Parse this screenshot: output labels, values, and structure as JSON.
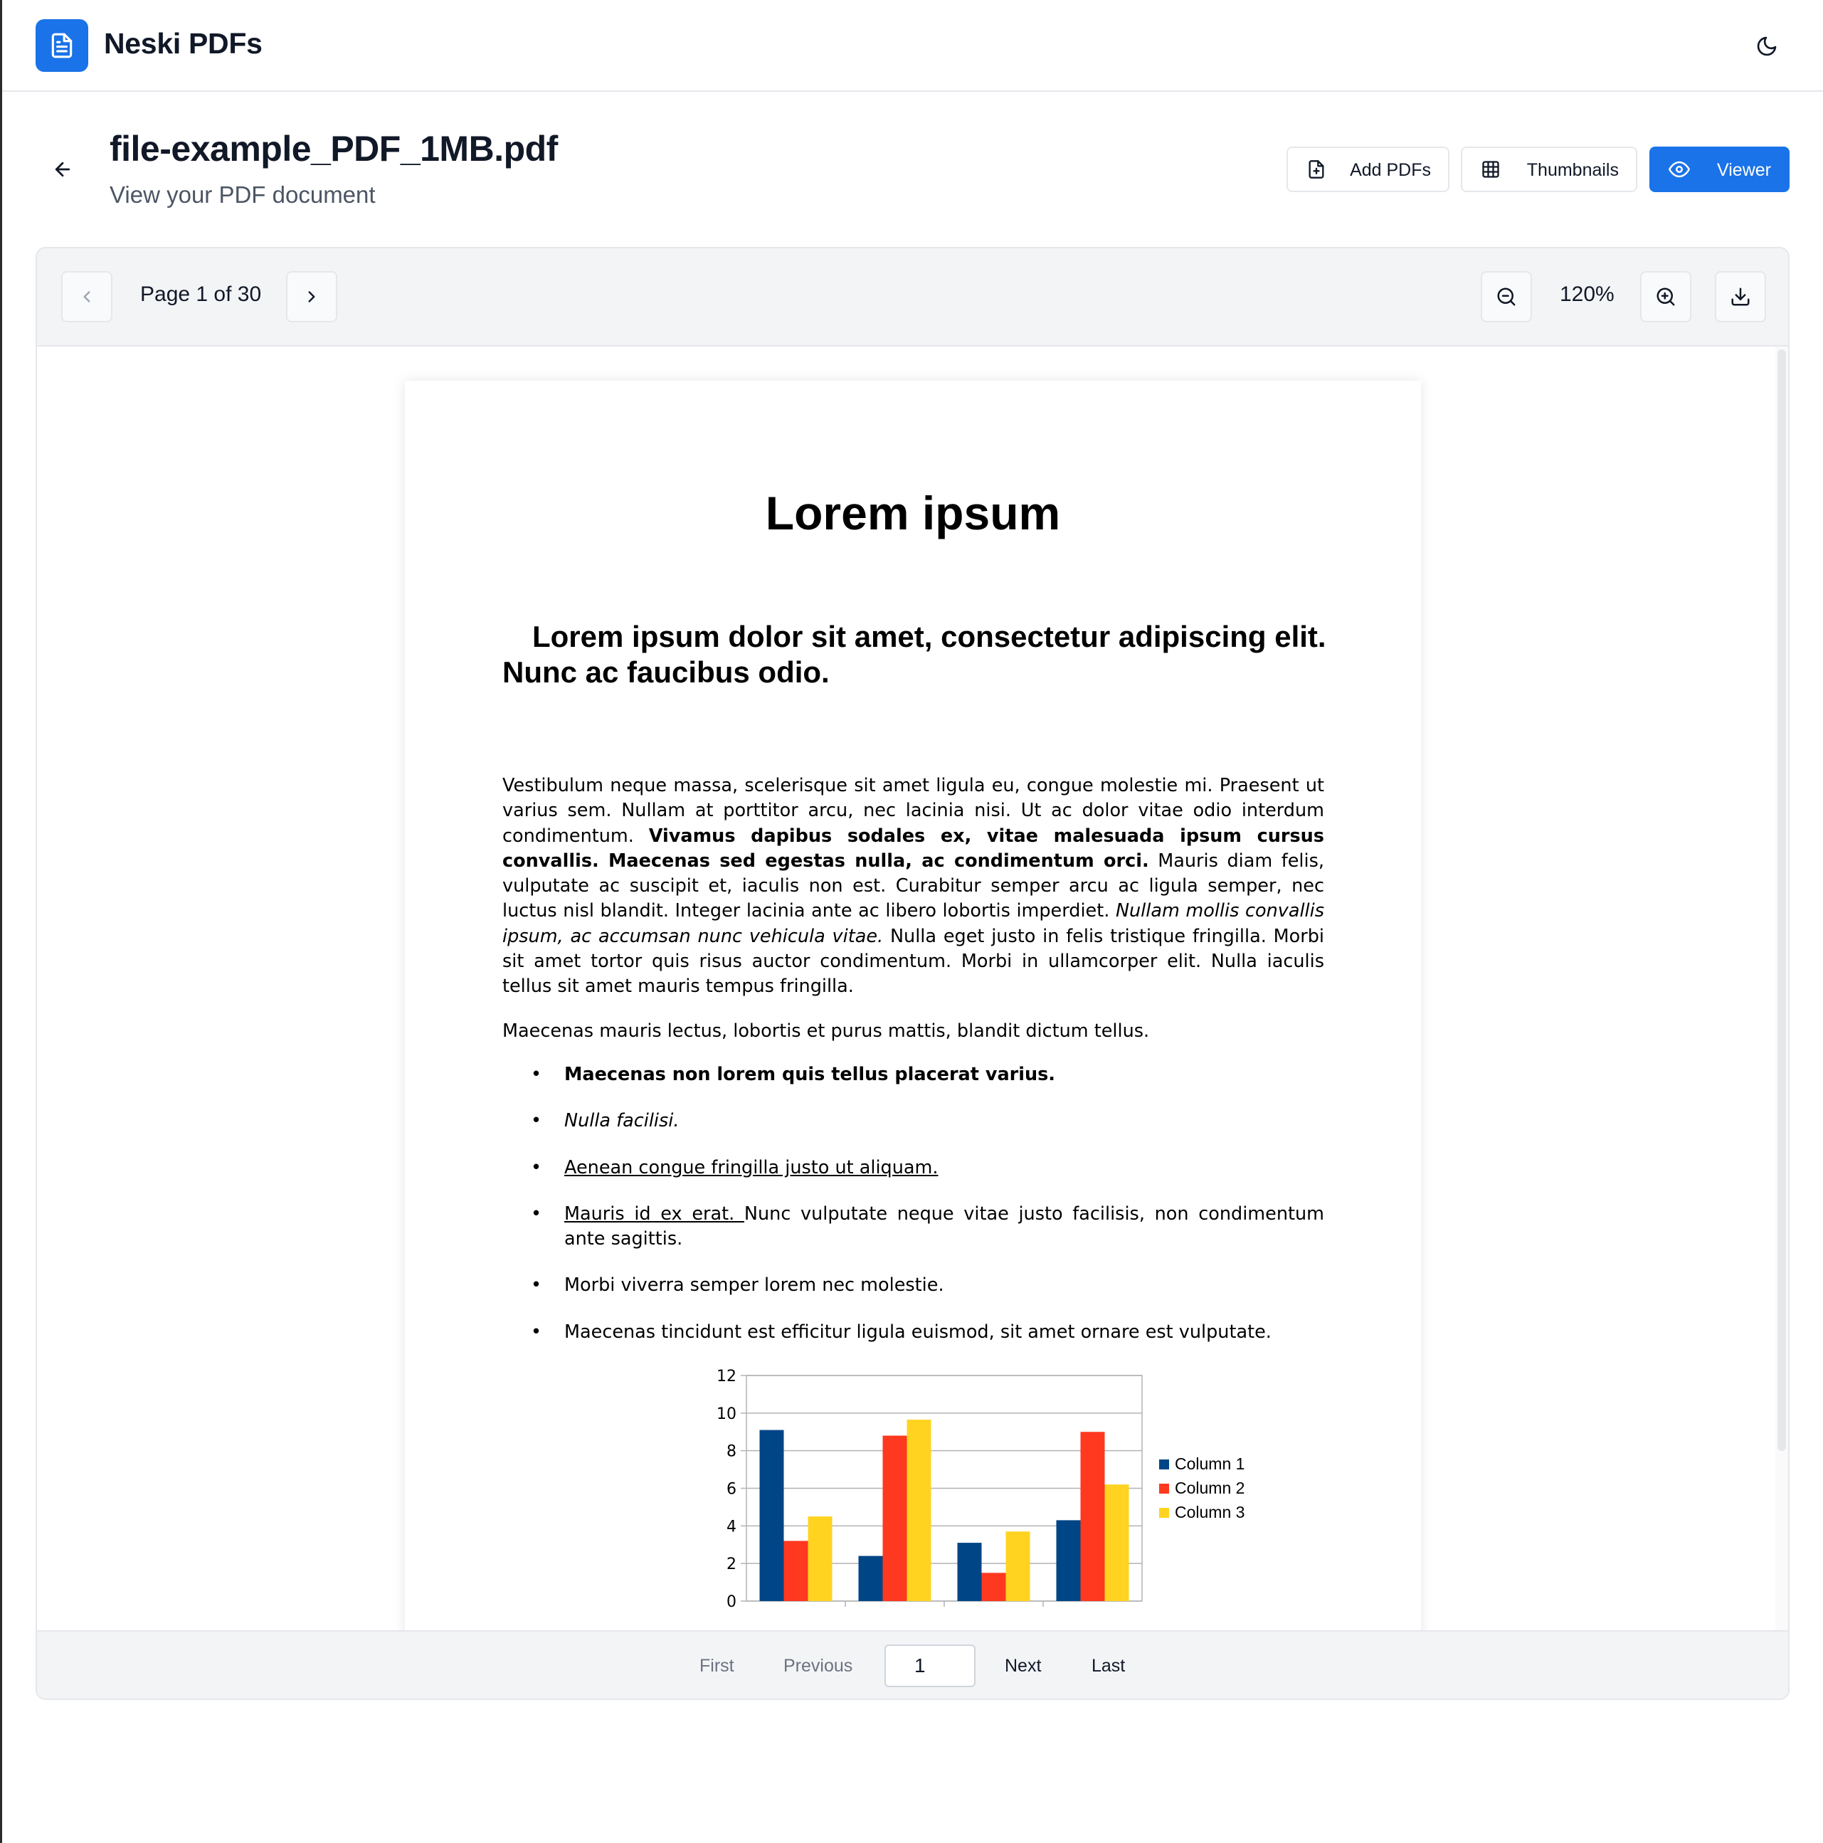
{
  "app": {
    "title": "Neski PDFs",
    "brand_color": "#1a73e8",
    "logo_icon": "file-text-icon",
    "theme_icon": "moon-icon"
  },
  "heading": {
    "title": "file-example_PDF_1MB.pdf",
    "subtitle": "View your PDF document",
    "back_icon": "arrow-left-icon"
  },
  "actions": {
    "add_pdfs": "Add PDFs",
    "thumbnails": "Thumbnails",
    "viewer": "Viewer"
  },
  "toolbar": {
    "page_indicator": "Page 1 of 30",
    "zoom": "120%"
  },
  "document": {
    "title": "Lorem ipsum",
    "heading": "Lorem ipsum dolor sit amet, consectetur adipiscing elit. Nunc ac faucibus odio.",
    "p1_a": "Vestibulum neque massa, scelerisque sit amet ligula eu, congue molestie mi. Praesent ut varius sem. Nullam at porttitor arcu, nec lacinia nisi. Ut ac dolor vitae odio interdum condimentum. ",
    "p1_bold": "Vivamus dapibus sodales ex, vitae malesuada ipsum cursus convallis. Maecenas sed egestas nulla, ac condimentum orci.",
    "p1_b": " Mauris diam felis, vulputate ac suscipit et, iaculis non est. Curabitur semper arcu ac ligula semper, nec luctus nisl blandit. Integer lacinia ante ac libero lobortis imperdiet. ",
    "p1_italic": "Nullam mollis convallis ipsum, ac accumsan nunc vehicula vitae.",
    "p1_c": " Nulla eget justo in felis tristique fringilla. Morbi sit amet tortor quis risus auctor condimentum. Morbi in ullamcorper elit. Nulla iaculis tellus sit amet mauris tempus fringilla.",
    "p2": "Maecenas mauris lectus, lobortis et purus mattis, blandit dictum tellus.",
    "list": {
      "item1": "Maecenas non lorem quis tellus placerat varius.",
      "item2": "Nulla facilisi.",
      "item3": "Aenean congue fringilla justo ut aliquam. ",
      "item4_link": "Mauris id ex erat. ",
      "item4_rest": "Nunc vulputate neque vitae justo facilisis, non condimentum ante sagittis.",
      "item5": "Morbi viverra semper lorem nec molestie.",
      "item6": "Maecenas tincidunt est efficitur ligula euismod, sit amet ornare est vulputate."
    }
  },
  "chart_data": {
    "type": "bar",
    "categories": [
      "",
      "",
      "",
      ""
    ],
    "series": [
      {
        "name": "Column 1",
        "color": "#004586",
        "values": [
          9.1,
          2.4,
          3.1,
          4.3
        ]
      },
      {
        "name": "Column 2",
        "color": "#ff3820",
        "values": [
          3.2,
          8.8,
          1.5,
          9.0
        ]
      },
      {
        "name": "Column 3",
        "color": "#ffd320",
        "values": [
          4.5,
          9.65,
          3.7,
          6.2
        ]
      }
    ],
    "yticks": [
      "0",
      "2",
      "4",
      "6",
      "8",
      "10",
      "12"
    ],
    "ylim": [
      0,
      12
    ],
    "grid": true,
    "legend": "right"
  },
  "pager": {
    "first": "First",
    "previous": "Previous",
    "page_value": "1",
    "next": "Next",
    "last": "Last"
  }
}
